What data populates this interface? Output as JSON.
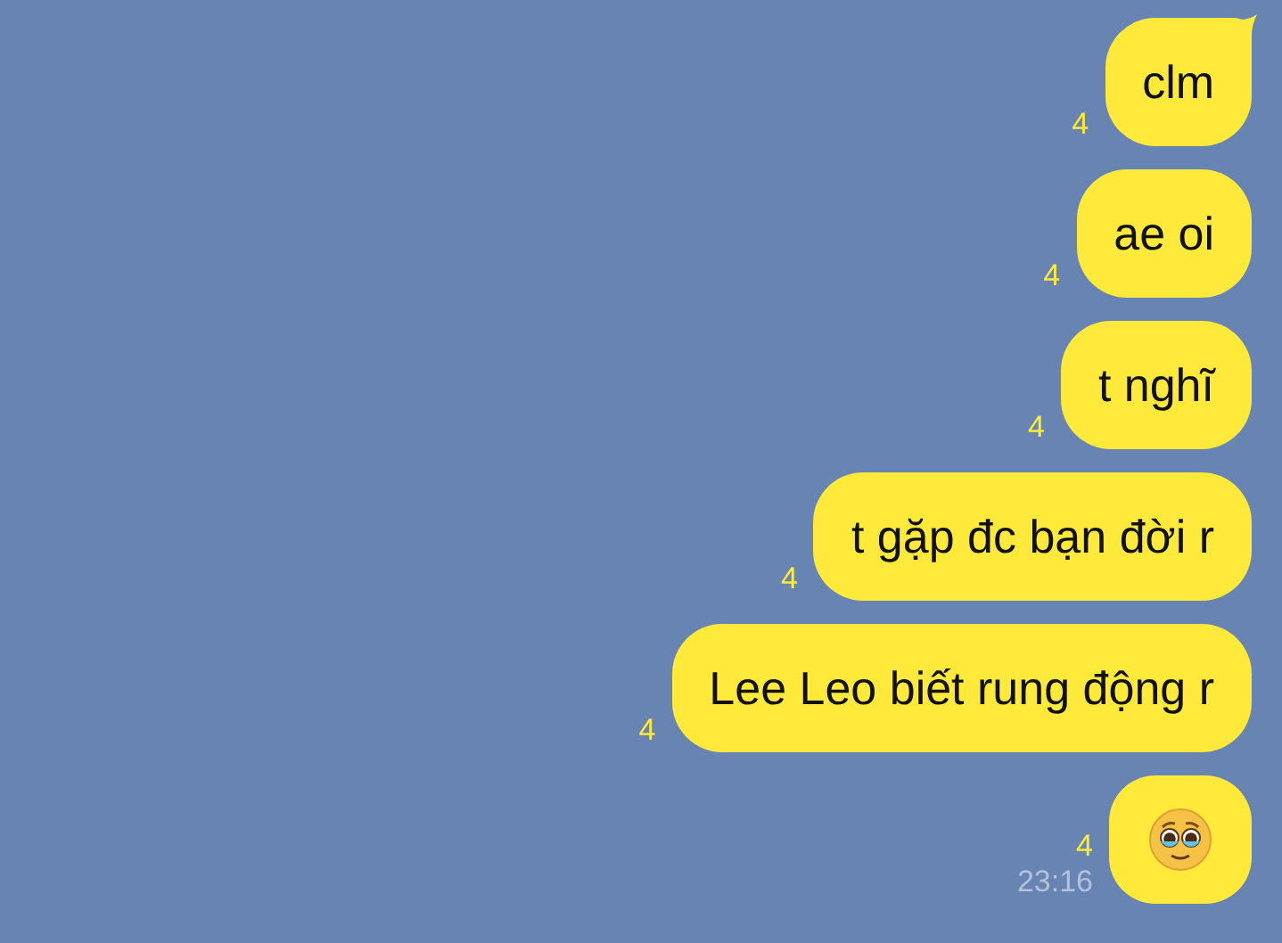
{
  "messages": [
    {
      "kind": "text",
      "text": "clm",
      "unread": "4",
      "tail": true
    },
    {
      "kind": "text",
      "text": "ae oi",
      "unread": "4",
      "tail": false
    },
    {
      "kind": "text",
      "text": "t nghĩ",
      "unread": "4",
      "tail": false
    },
    {
      "kind": "text",
      "text": "t gặp đc bạn đời r",
      "unread": "4",
      "tail": false
    },
    {
      "kind": "text",
      "text": "Lee Leo biết rung động r",
      "unread": "4",
      "tail": false
    },
    {
      "kind": "emoji",
      "unread": "4",
      "time": "23:16",
      "tail": false
    }
  ]
}
